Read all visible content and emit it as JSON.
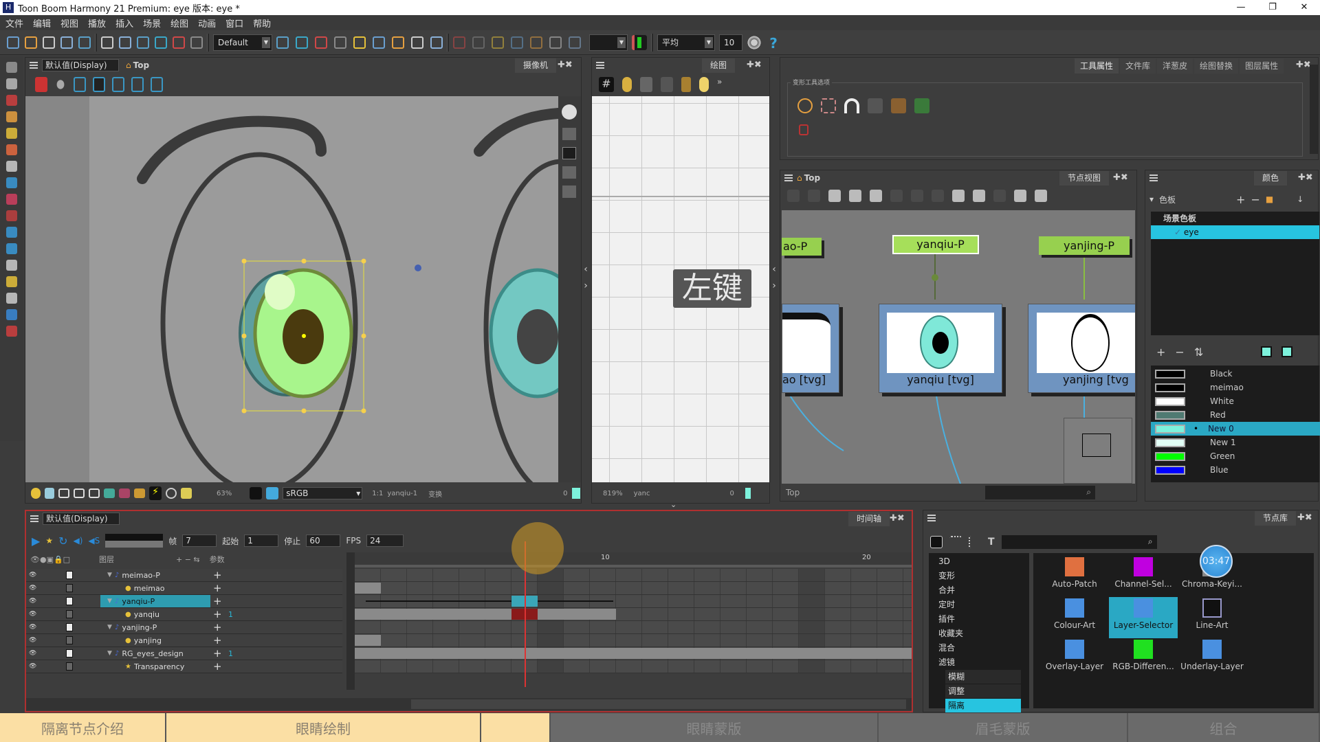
{
  "app": {
    "title": "Toon Boom Harmony 21 Premium: eye 版本: eye *",
    "window_controls": [
      "—",
      "❐",
      "✕"
    ]
  },
  "menu": [
    "文件",
    "编辑",
    "视图",
    "播放",
    "插入",
    "场景",
    "绘图",
    "动画",
    "窗口",
    "帮助"
  ],
  "toolbar": {
    "icons_left": [
      "new-scene-icon",
      "open-icon",
      "save-icon",
      "save-as-icon",
      "import-icon"
    ],
    "icons_edit": [
      "undo-icon",
      "redo-icon",
      "cut-icon",
      "copy-icon",
      "paste-icon",
      "library-icon"
    ],
    "workspace_value": "Default",
    "icons_mid": [
      "workspace-manager-icon",
      "pivot-icon",
      "rotate-icon",
      "scale-icon",
      "skew-icon",
      "transform-icon",
      "motion-icon",
      "peg-icon",
      "node-icon"
    ],
    "icons_right": [
      "deform-icon",
      "bone-icon",
      "curve-icon",
      "envelope-icon",
      "offset-icon",
      "weight-icon",
      "kinematic-icon"
    ],
    "smoothing_value": "平均",
    "smoothing_amount": "10"
  },
  "camera_panel": {
    "view_mode": "默认值(Display)",
    "breadcrumb": "Top",
    "tab": "摄像机",
    "status": {
      "zoom": "63%",
      "color_space": "sRGB",
      "ratio": "1:1",
      "layer": "yanqiu-1",
      "mode": "变换",
      "frame": "0"
    }
  },
  "drawing_panel": {
    "tab": "绘图",
    "overlay_key": "左键",
    "status": {
      "zoom": "819%",
      "layer": "yanc",
      "frame": "0"
    }
  },
  "tool_properties": {
    "tabs": [
      "工具属性",
      "文件库",
      "洋葱皮",
      "绘图替换",
      "图层属性"
    ],
    "group_label": "变形工具选项"
  },
  "node_view": {
    "breadcrumb": "Top",
    "tab": "节点视图",
    "footer": "Top",
    "nodes": {
      "peg_left": "ao-P",
      "peg_mid": "yanqiu-P",
      "peg_right": "yanjing-P",
      "draw_left": "ao  [tvg]",
      "draw_mid": "yanqiu  [tvg]",
      "draw_right": "yanjing  [tvg"
    }
  },
  "color_panel": {
    "tab": "颜色",
    "palette_header": "色板",
    "scene_palette": "场景色板",
    "selected_palette": "eye",
    "colors": [
      {
        "name": "Black",
        "hex": "#000000"
      },
      {
        "name": "meimao",
        "hex": "#000000"
      },
      {
        "name": "White",
        "hex": "#ffffff"
      },
      {
        "name": "Red",
        "hex": "#4f7a72"
      },
      {
        "name": "New 0",
        "hex": "#7df2dc",
        "selected": true
      },
      {
        "name": "New 1",
        "hex": "#e2fff6"
      },
      {
        "name": "Green",
        "hex": "#00ff00"
      },
      {
        "name": "Blue",
        "hex": "#0000ff"
      }
    ]
  },
  "timeline": {
    "view_mode": "默认值(Display)",
    "tab": "时间轴",
    "frame_label": "帧",
    "frame": "7",
    "start_label": "起始",
    "start": "1",
    "stop_label": "停止",
    "stop": "60",
    "fps_label": "FPS",
    "fps": "24",
    "layers_header": "图层",
    "params_header": "参数",
    "ruler": [
      "10",
      "20"
    ],
    "current_frame": 7,
    "layers": [
      {
        "name": "meimao-P",
        "indent": 0,
        "expand": true,
        "param": ""
      },
      {
        "name": "meimao",
        "indent": 1,
        "param": ""
      },
      {
        "name": "yanqiu-P",
        "indent": 0,
        "expand": true,
        "selected": true,
        "param": ""
      },
      {
        "name": "yanqiu",
        "indent": 1,
        "param": "1"
      },
      {
        "name": "yanjing-P",
        "indent": 0,
        "expand": true,
        "param": ""
      },
      {
        "name": "yanjing",
        "indent": 1,
        "param": ""
      },
      {
        "name": "RG_eyes_design",
        "indent": 0,
        "expand": true,
        "param": "1"
      },
      {
        "name": "Transparency",
        "indent": 1,
        "param": ""
      }
    ]
  },
  "node_library": {
    "tab": "节点库",
    "categories": [
      "3D",
      "变形",
      "合并",
      "定时",
      "插件",
      "收藏夹",
      "混合",
      "滤镜",
      "模糊",
      "调整",
      "隔离"
    ],
    "selected_category": "隔离",
    "nodes": [
      "Auto-Patch",
      "Channel-Sel...",
      "Chroma-Keyi...",
      "Colour-Art",
      "Layer-Selector",
      "Line-Art",
      "Overlay-Layer",
      "RGB-Differen...",
      "Underlay-Layer"
    ],
    "selected_node": "Layer-Selector",
    "timer_badge": "03:47"
  },
  "chapters": [
    {
      "label": "隔离节点介绍",
      "active": true
    },
    {
      "label": "眼睛绘制",
      "active": true
    },
    {
      "label": "",
      "active": true
    },
    {
      "label": "眼睛蒙版",
      "active": false
    },
    {
      "label": "眉毛蒙版",
      "active": false
    },
    {
      "label": "组合",
      "active": false
    }
  ],
  "colors": {
    "accent": "#27b9d6",
    "timeline_border": "#b03030",
    "chapter_active": "#fbdfa4",
    "chapter_inactive": "#6a6a6a"
  }
}
